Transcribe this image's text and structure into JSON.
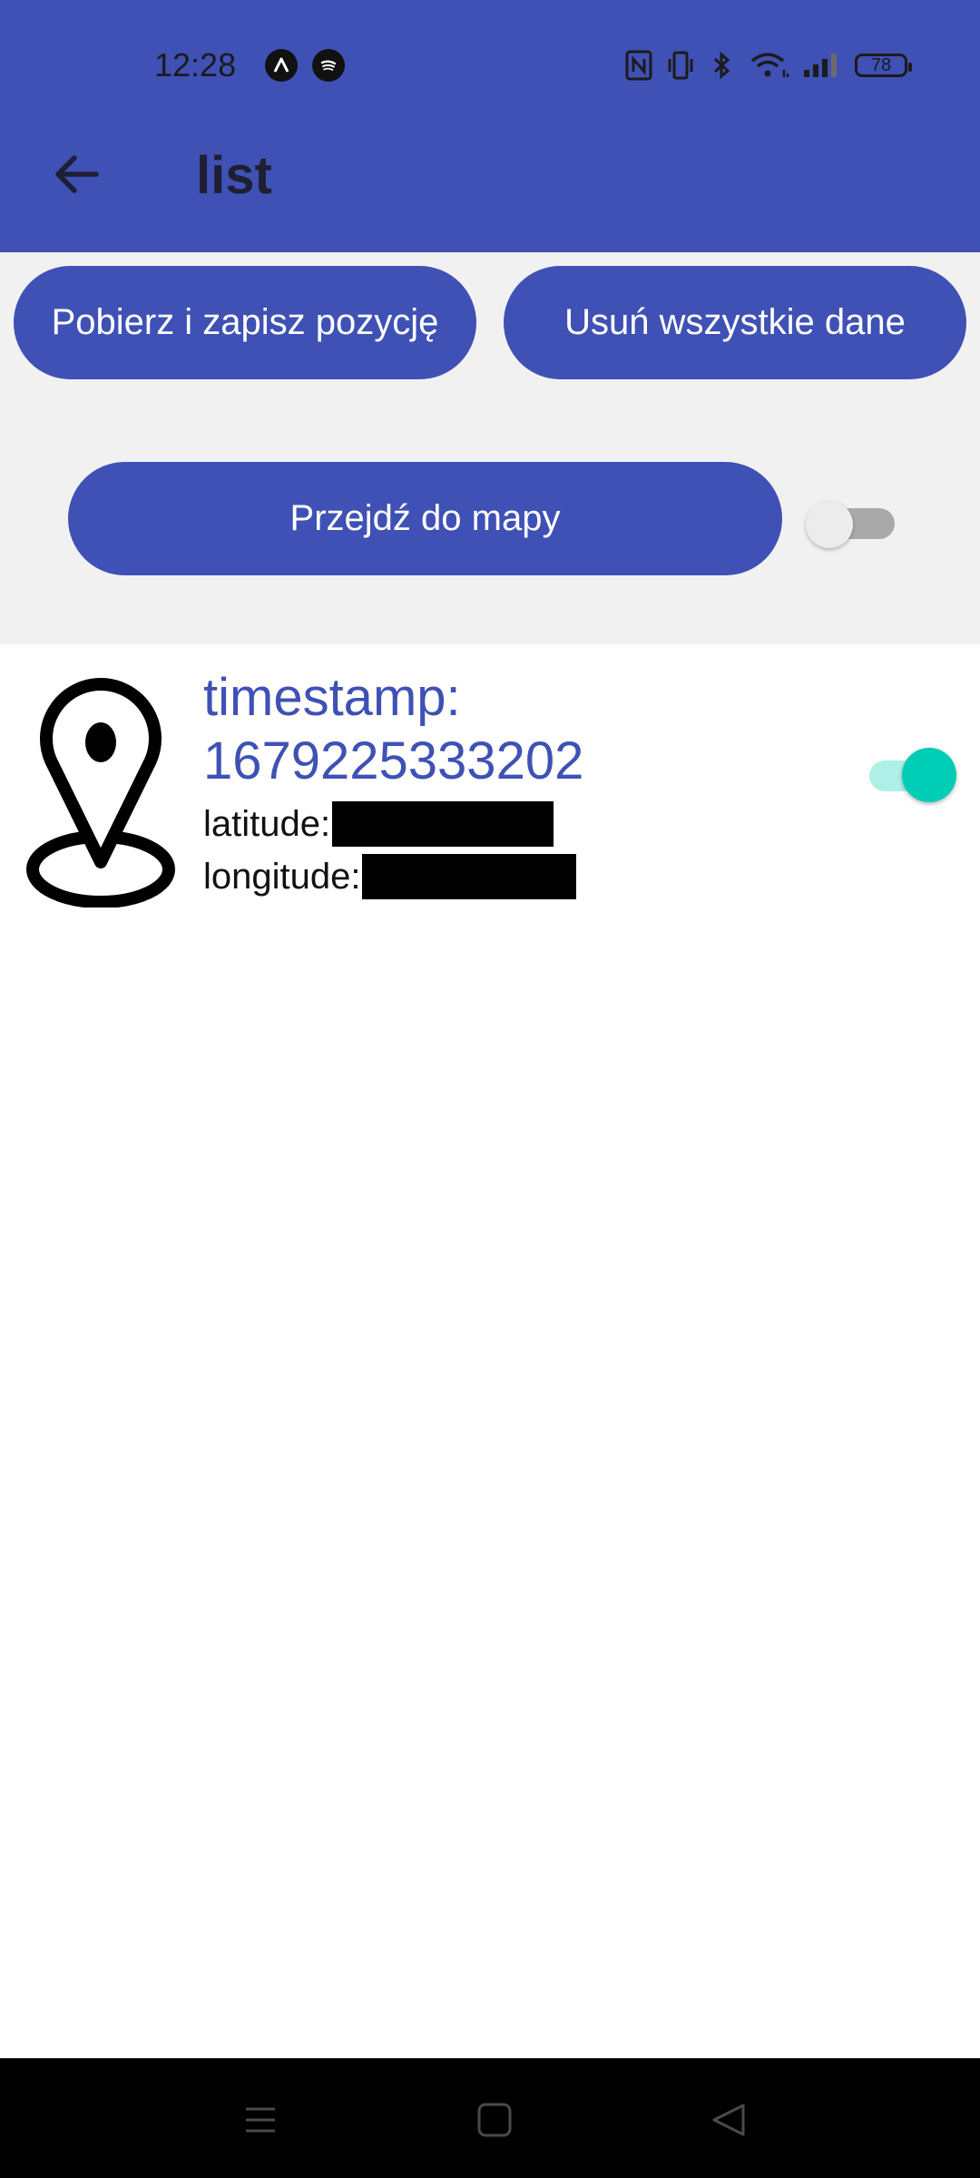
{
  "status_bar": {
    "time": "12:28",
    "battery_level": "78",
    "icons": [
      "app-icon",
      "spotify-icon",
      "nfc-icon",
      "vibrate-icon",
      "bluetooth-icon",
      "wifi-icon",
      "signal-icon",
      "battery-icon"
    ]
  },
  "app_bar": {
    "back_icon": "arrow-left-icon",
    "title": "list"
  },
  "actions": {
    "save_position_label": "Pobierz i zapisz pozycję",
    "delete_all_label": "Usuń wszystkie dane",
    "go_to_map_label": "Przejdź do mapy",
    "toggle_checked": false
  },
  "locations": [
    {
      "timestamp_label": "timestamp:",
      "timestamp": "1679225333202",
      "latitude_label": "latitude:",
      "longitude_label": "longitude:",
      "toggle_checked": true
    }
  ],
  "colors": {
    "primary": "#3f51b5",
    "accent": "#00cdb6",
    "background": "#f1f1f2"
  },
  "nav_bar": {
    "icons": [
      "recents-icon",
      "home-icon",
      "back-triangle-icon"
    ]
  }
}
